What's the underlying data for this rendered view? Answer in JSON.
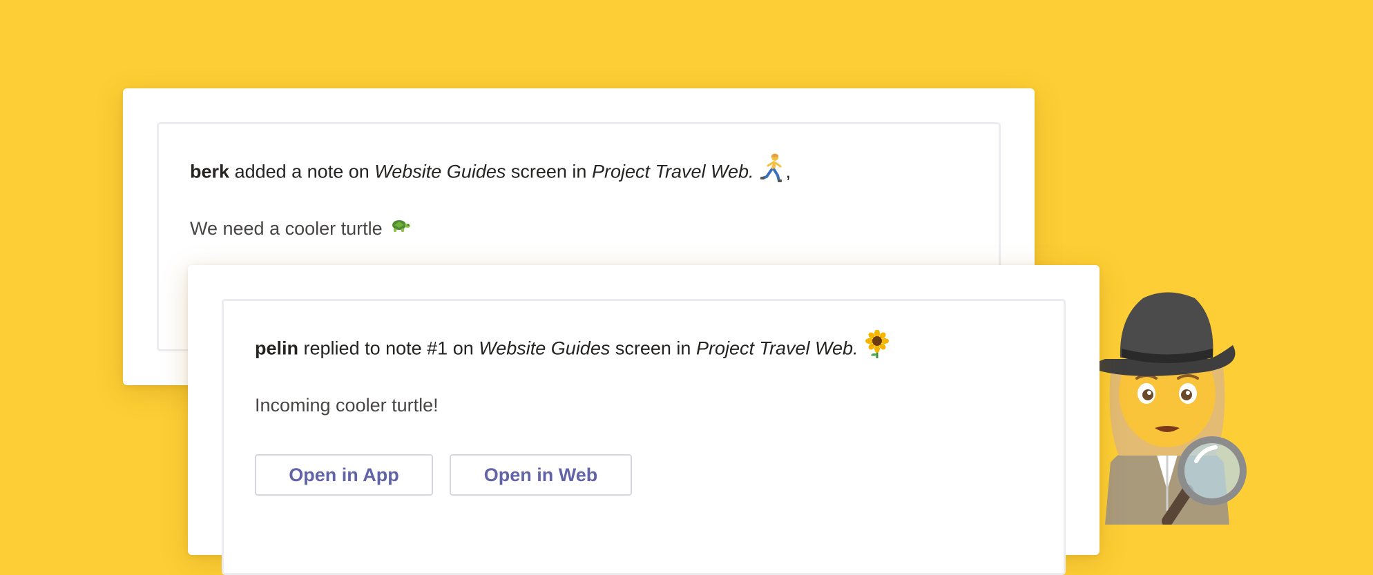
{
  "note": {
    "author": "berk",
    "action": "added a note on",
    "screen": "Website Guides",
    "screen_suffix": "screen in",
    "project": "Project Travel Web.",
    "trailing": ",",
    "message": "We need a cooler turtle",
    "emoji_runner": "woman-running-icon",
    "emoji_turtle": "turtle-icon"
  },
  "reply": {
    "author": "pelin",
    "action": "replied to note #1 on",
    "screen": "Website Guides",
    "screen_suffix": "screen in",
    "project": "Project Travel Web.",
    "message": "Incoming cooler turtle!",
    "emoji_sunflower": "sunflower-icon",
    "buttons": {
      "open_app": "Open in App",
      "open_web": "Open in Web"
    }
  },
  "decoration": {
    "detective": "woman-detective-icon"
  },
  "colors": {
    "background": "#FDCE35",
    "card": "#FFFFFF",
    "button_text": "#6264A7",
    "text": "#252423"
  }
}
